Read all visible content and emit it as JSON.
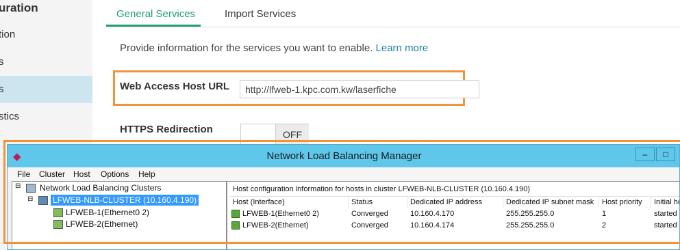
{
  "left_nav": {
    "title": "uration",
    "items": [
      {
        "label": "tion",
        "active": false
      },
      {
        "label": "s",
        "active": false
      },
      {
        "label": "s",
        "active": true
      },
      {
        "label": "stics",
        "active": false
      }
    ]
  },
  "tabs": [
    {
      "label": "General Services",
      "active": true
    },
    {
      "label": "Import Services",
      "active": false
    }
  ],
  "description": {
    "text": "Provide information for the services you want to enable. ",
    "link": "Learn more"
  },
  "web_access": {
    "label": "Web Access Host URL",
    "value": "http://lfweb-1.kpc.com.kw/laserfiche"
  },
  "https_redirection": {
    "label": "HTTPS Redirection",
    "toggle": "OFF"
  },
  "nlb_window": {
    "title": "Network Load Balancing Manager",
    "controls": {
      "minimize": "‒",
      "maximize": "□"
    },
    "menu": [
      "File",
      "Cluster",
      "Host",
      "Options",
      "Help"
    ],
    "tree": {
      "root": "Network Load Balancing Clusters",
      "cluster": "LFWEB-NLB-CLUSTER (10.160.4.190)",
      "hosts": [
        "LFWEB-1(Ethernet0 2)",
        "LFWEB-2(Ethernet)"
      ]
    },
    "details": {
      "caption": "Host configuration information for hosts in cluster LFWEB-NLB-CLUSTER (10.160.4.190)",
      "columns": [
        "Host (Interface)",
        "Status",
        "Dedicated IP address",
        "Dedicated IP subnet mask",
        "Host priority",
        "Initial ho"
      ],
      "rows": [
        [
          "LFWEB-1(Ethernet0 2)",
          "Converged",
          "10.160.4.170",
          "255.255.255.0",
          "1",
          "started"
        ],
        [
          "LFWEB-2(Ethernet)",
          "Converged",
          "10.160.4.174",
          "255.255.255.0",
          "2",
          "started"
        ]
      ]
    }
  },
  "colors": {
    "accent_green": "#1f9e6e",
    "highlight_orange": "#f39237",
    "titlebar_blue": "#5ec7ea"
  }
}
